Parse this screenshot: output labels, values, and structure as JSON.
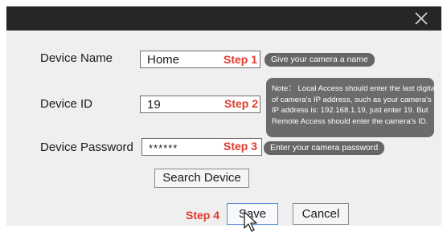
{
  "dialog": {
    "close_icon": "close-icon",
    "device_name": {
      "label": "Device Name",
      "value": "Home",
      "step": "Step 1",
      "tip": "Give your camera a name"
    },
    "device_id": {
      "label": "Device ID",
      "value": "19",
      "step": "Step 2",
      "note_lines": [
        "Note： Local Access should enter the last digital",
        "of camera's IP address, such as your camera's",
        "IP address is: 192.168.1.19, just enter 19. But",
        "Remote Access should enter the camera's ID."
      ]
    },
    "device_password": {
      "label": "Device Password",
      "value": "******",
      "step": "Step 3",
      "tip": "Enter your camera password"
    },
    "search_button": "Search Device",
    "step4": "Step 4",
    "save_button": "Save",
    "cancel_button": "Cancel"
  },
  "colors": {
    "title_bar": "#262626",
    "dialog_bg": "#efefef",
    "step_red": "#e23a2a",
    "tip_gray": "#666666"
  }
}
